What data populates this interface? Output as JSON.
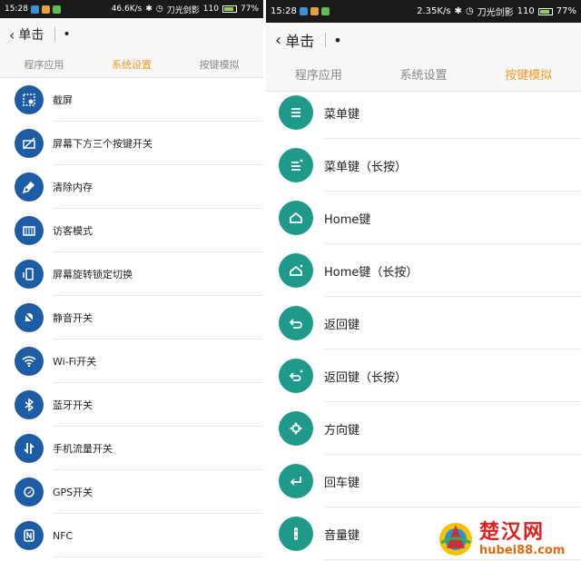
{
  "left": {
    "status": {
      "time": "15:28",
      "speed": "46.6K/s",
      "carrier": "刀光剑影",
      "signal": "110",
      "battery": "77%"
    },
    "nav": {
      "back_label": "单击",
      "dot": "•"
    },
    "tabs": [
      "程序应用",
      "系统设置",
      "按键模拟"
    ],
    "items": [
      {
        "label": "截屏",
        "icon": "screenshot-icon"
      },
      {
        "label": "屏幕下方三个按键开关",
        "icon": "button-toggle-icon"
      },
      {
        "label": "清除内存",
        "icon": "broom-icon"
      },
      {
        "label": "访客模式",
        "icon": "guest-mode-icon"
      },
      {
        "label": "屏幕旋转锁定切换",
        "icon": "rotation-lock-icon"
      },
      {
        "label": "静音开关",
        "icon": "mute-icon"
      },
      {
        "label": "Wi-Fi开关",
        "icon": "wifi-icon"
      },
      {
        "label": "蓝牙开关",
        "icon": "bluetooth-icon"
      },
      {
        "label": "手机流量开关",
        "icon": "data-toggle-icon"
      },
      {
        "label": "GPS开关",
        "icon": "gps-icon"
      },
      {
        "label": "NFC",
        "icon": "nfc-icon"
      }
    ]
  },
  "right": {
    "status": {
      "time": "15:28",
      "speed": "2.35K/s",
      "carrier": "刀光剑影",
      "signal": "110",
      "battery": "77%"
    },
    "nav": {
      "back_label": "单击",
      "dot": "•"
    },
    "tabs": [
      "程序应用",
      "系统设置",
      "按键模拟"
    ],
    "items": [
      {
        "label": "菜单键",
        "icon": "menu-icon"
      },
      {
        "label": "菜单键（长按）",
        "icon": "menu-long-press-icon"
      },
      {
        "label": "Home键",
        "icon": "home-icon"
      },
      {
        "label": "Home键（长按）",
        "icon": "home-long-press-icon"
      },
      {
        "label": "返回键",
        "icon": "back-icon"
      },
      {
        "label": "返回键（长按）",
        "icon": "back-long-press-icon"
      },
      {
        "label": "方向键",
        "icon": "dpad-icon"
      },
      {
        "label": "回车键",
        "icon": "enter-icon"
      },
      {
        "label": "音量键",
        "icon": "volume-icon"
      }
    ]
  },
  "watermark": {
    "cn": "楚汉网",
    "url": "hubei88.com"
  },
  "colors": {
    "accent": "#f09a26",
    "left_icon_bg": "#1c5da6",
    "right_icon_bg": "#1f9a8a"
  }
}
